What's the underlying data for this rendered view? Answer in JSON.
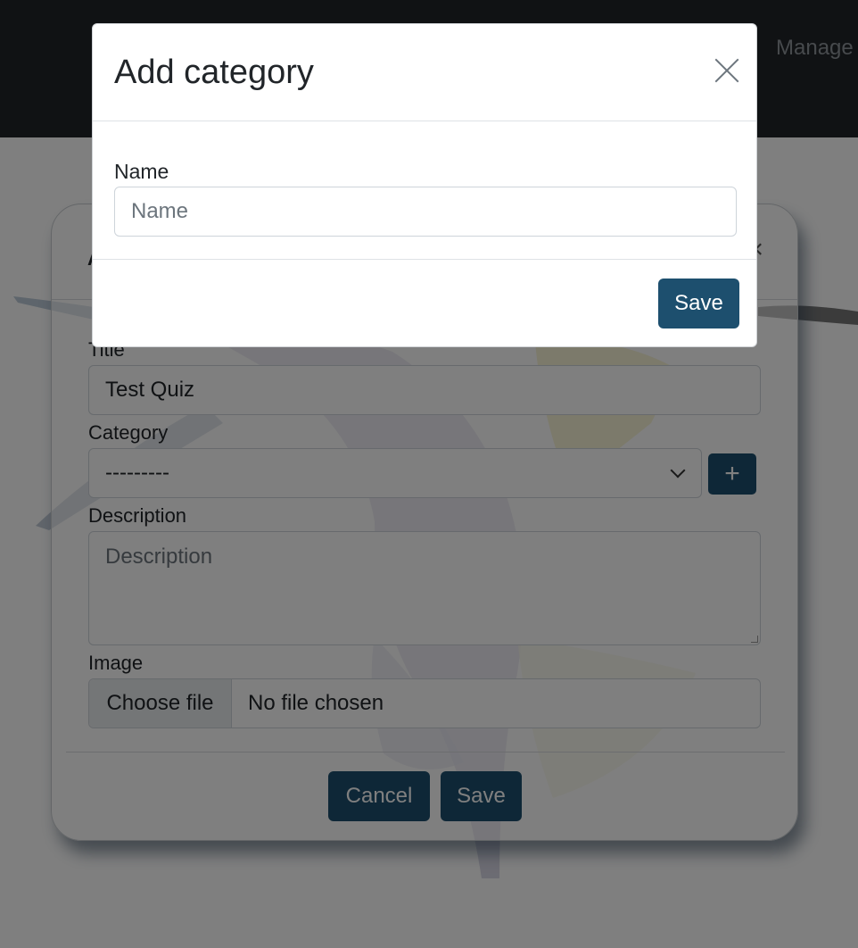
{
  "navbar": {
    "link_label": "Manage"
  },
  "form": {
    "header_title": "A",
    "close_glyph": "×",
    "title_label": "Title",
    "title_value": "Test Quiz",
    "category_label": "Category",
    "category_selected": "---------",
    "add_category_glyph": "+",
    "description_label": "Description",
    "description_placeholder": "Description",
    "image_label": "Image",
    "file_button_label": "Choose file",
    "file_status": "No file chosen",
    "cancel_label": "Cancel",
    "save_label": "Save"
  },
  "modal": {
    "title": "Add category",
    "name_label": "Name",
    "name_placeholder": "Name",
    "save_label": "Save"
  },
  "colors": {
    "primary": "#1d4f6e",
    "navbar": "#212529"
  },
  "icons": {
    "close": "close-icon",
    "chevron": "chevron-down-icon",
    "plus": "plus-icon"
  }
}
